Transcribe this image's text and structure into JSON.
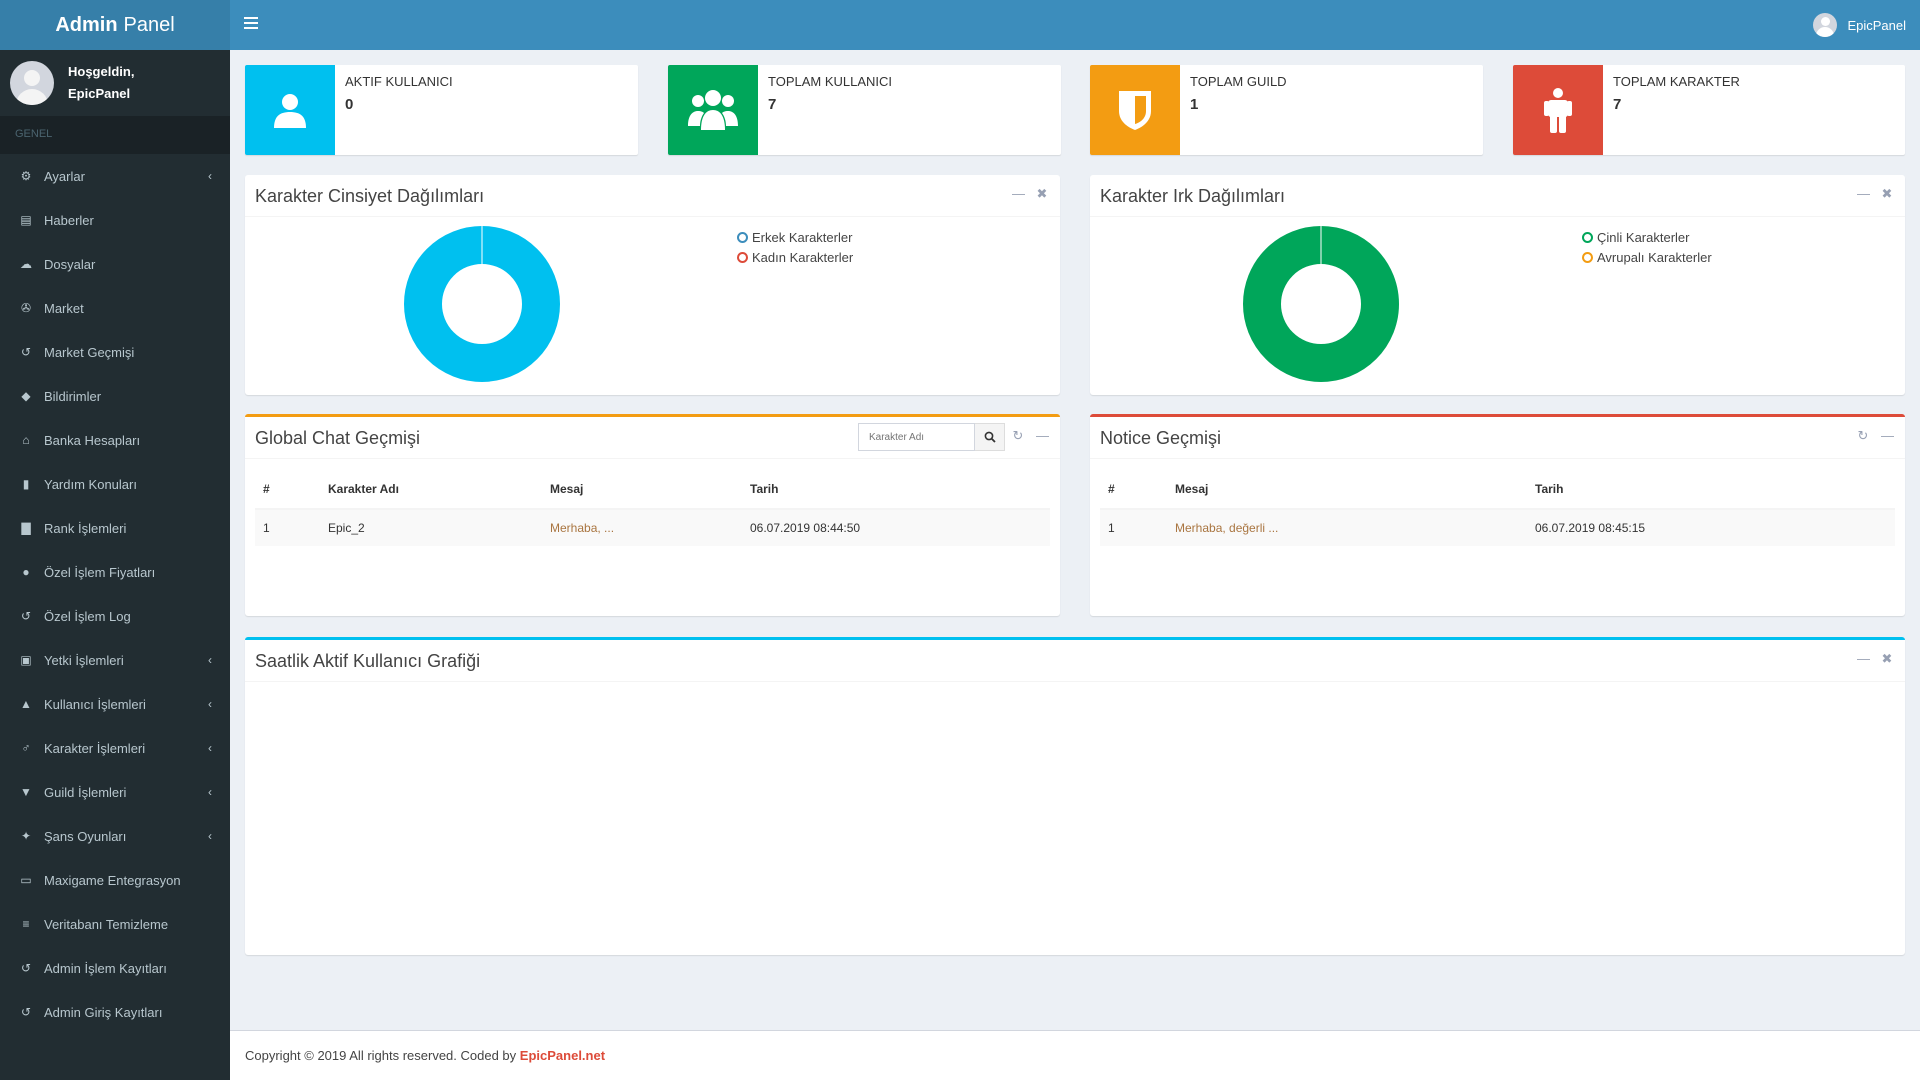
{
  "app": {
    "logo_bold": "Admin",
    "logo_light": "Panel",
    "user_name": "EpicPanel"
  },
  "sidebar": {
    "welcome_line1": "Hoşgeldin,",
    "welcome_line2": "EpicPanel",
    "section_header": "GENEL",
    "items": [
      {
        "label": "Ayarlar",
        "icon": "cogs-icon",
        "expandable": true
      },
      {
        "label": "Haberler",
        "icon": "newspaper-icon",
        "expandable": false
      },
      {
        "label": "Dosyalar",
        "icon": "cloud-download-icon",
        "expandable": false
      },
      {
        "label": "Market",
        "icon": "cart-icon",
        "expandable": false
      },
      {
        "label": "Market Geçmişi",
        "icon": "history-icon",
        "expandable": false
      },
      {
        "label": "Bildirimler",
        "icon": "ticket-icon",
        "expandable": false
      },
      {
        "label": "Banka Hesapları",
        "icon": "bank-icon",
        "expandable": false
      },
      {
        "label": "Yardım Konuları",
        "icon": "book-icon",
        "expandable": false
      },
      {
        "label": "Rank İşlemleri",
        "icon": "bar-chart-icon",
        "expandable": false
      },
      {
        "label": "Özel İşlem Fiyatları",
        "icon": "coin-icon",
        "expandable": false
      },
      {
        "label": "Özel İşlem Log",
        "icon": "history-icon",
        "expandable": false
      },
      {
        "label": "Yetki İşlemleri",
        "icon": "lock-icon",
        "expandable": true
      },
      {
        "label": "Kullanıcı İşlemleri",
        "icon": "user-icon",
        "expandable": true
      },
      {
        "label": "Karakter İşlemleri",
        "icon": "male-icon",
        "expandable": true
      },
      {
        "label": "Guild İşlemleri",
        "icon": "shield-icon",
        "expandable": true
      },
      {
        "label": "Şans Oyunları",
        "icon": "puzzle-icon",
        "expandable": true
      },
      {
        "label": "Maxigame Entegrasyon",
        "icon": "credit-card-icon",
        "expandable": false
      },
      {
        "label": "Veritabanı Temizleme",
        "icon": "database-icon",
        "expandable": false
      },
      {
        "label": "Admin İşlem Kayıtları",
        "icon": "history-icon",
        "expandable": false
      },
      {
        "label": "Admin Giriş Kayıtları",
        "icon": "history-icon",
        "expandable": false
      }
    ]
  },
  "stats": [
    {
      "label": "AKTIF KULLANICI",
      "value": "0",
      "color": "#00c0ef",
      "icon": "user-icon"
    },
    {
      "label": "TOPLAM KULLANICI",
      "value": "7",
      "color": "#00a65a",
      "icon": "users-icon"
    },
    {
      "label": "TOPLAM GUILD",
      "value": "1",
      "color": "#f39c12",
      "icon": "shield-icon"
    },
    {
      "label": "TOPLAM KARAKTER",
      "value": "7",
      "color": "#dd4b39",
      "icon": "male-icon"
    }
  ],
  "gender_box": {
    "title": "Karakter Cinsiyet Dağılımları",
    "legend": [
      {
        "label": "Erkek Karakterler",
        "color": "#3c8dbc"
      },
      {
        "label": "Kadın Karakterler",
        "color": "#dd4b39"
      }
    ]
  },
  "race_box": {
    "title": "Karakter Irk Dağılımları",
    "legend": [
      {
        "label": "Çinli Karakterler",
        "color": "#00a65a"
      },
      {
        "label": "Avrupalı Karakterler",
        "color": "#f39c12"
      }
    ]
  },
  "chart_data": [
    {
      "type": "pie",
      "categories": [
        "Erkek Karakterler",
        "Kadın Karakterler"
      ],
      "values": [
        7,
        0
      ],
      "colors": [
        "#00c0ef",
        "#dd4b39"
      ],
      "title": "Karakter Cinsiyet Dağılımları",
      "legend": "top-right"
    },
    {
      "type": "pie",
      "categories": [
        "Çinli Karakterler",
        "Avrupalı Karakterler"
      ],
      "values": [
        7,
        0
      ],
      "colors": [
        "#00a65a",
        "#f39c12"
      ],
      "title": "Karakter Irk Dağılımları",
      "legend": "top-right"
    }
  ],
  "chat_box": {
    "title": "Global Chat Geçmişi",
    "search_placeholder": "Karakter Adı",
    "headers": [
      "#",
      "Karakter Adı",
      "Mesaj",
      "Tarih"
    ],
    "rows": [
      {
        "no": "1",
        "name": "Epic_2",
        "message": "Merhaba, ...",
        "date": "06.07.2019 08:44:50"
      }
    ],
    "accent": "#f39c12"
  },
  "notice_box": {
    "title": "Notice Geçmişi",
    "headers": [
      "#",
      "Mesaj",
      "Tarih"
    ],
    "rows": [
      {
        "no": "1",
        "message": "Merhaba, değerli ...",
        "date": "06.07.2019 08:45:15"
      }
    ],
    "accent": "#dd4b39"
  },
  "hourly_box": {
    "title": "Saatlik Aktif Kullanıcı Grafiği",
    "accent": "#00c0ef"
  },
  "footer": {
    "text": "Copyright © 2019 All rights reserved. Coded by",
    "link": "EpicPanel.net"
  }
}
